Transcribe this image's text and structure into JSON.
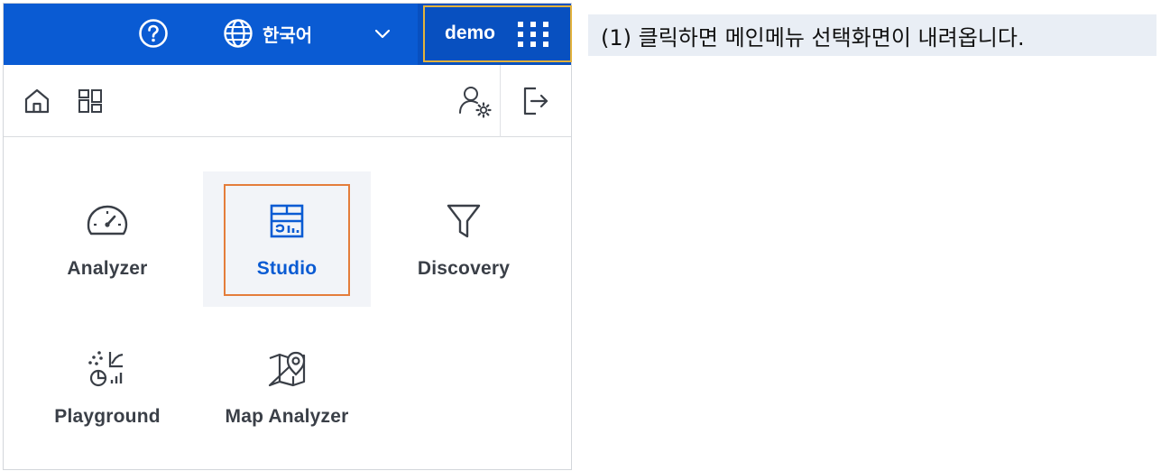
{
  "topbar": {
    "language_label": "한국어",
    "user_label": "demo"
  },
  "menu": {
    "items": [
      {
        "label": "Analyzer",
        "icon": "speedometer-icon"
      },
      {
        "label": "Studio",
        "icon": "studio-dashboard-icon",
        "selected": true
      },
      {
        "label": "Discovery",
        "icon": "filter-icon"
      },
      {
        "label": "Playground",
        "icon": "playground-chart-icon"
      },
      {
        "label": "Map Analyzer",
        "icon": "map-pin-icon"
      }
    ]
  },
  "caption": {
    "text": "(1) 클릭하면 메인메뉴 선택화면이 내려옵니다."
  },
  "colors": {
    "brand_blue": "#0a5bd3",
    "highlight_yellow": "#e3b23c",
    "highlight_orange": "#e47d3b"
  }
}
